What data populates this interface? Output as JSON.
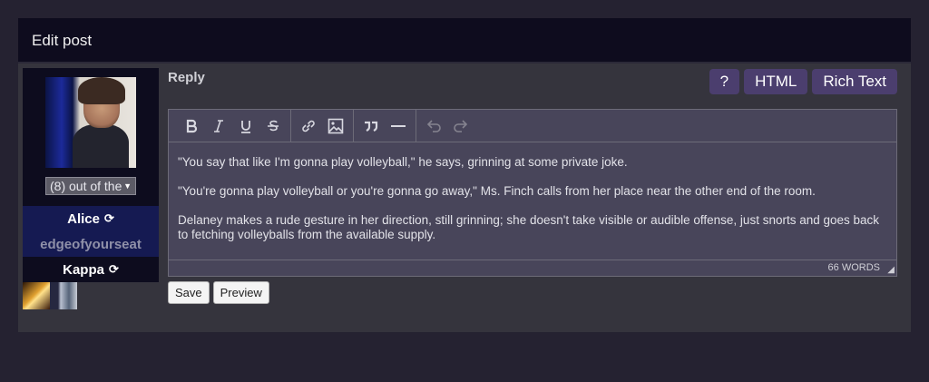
{
  "header": {
    "title": "Edit post"
  },
  "sidebar": {
    "select_value": "(8) out of the",
    "character": "Alice",
    "subtitle": "edgeofyourseat",
    "player": "Kappa"
  },
  "main": {
    "reply_label": "Reply",
    "mode_buttons": [
      "?",
      "HTML",
      "Rich Text"
    ]
  },
  "editor": {
    "paragraphs": [
      "\"You say that like I'm gonna play volleyball,\" he says, grinning at some private joke.",
      "\"You're gonna play volleyball or you're gonna go away,\" Ms. Finch calls from her place near the other end of the room.",
      "Delaney makes a rude gesture in her direction, still grinning; she doesn't take visible or audible offense, just snorts and goes back to fetching volleyballs from the available supply."
    ],
    "word_count": "66 WORDS"
  },
  "actions": {
    "save": "Save",
    "preview": "Preview"
  }
}
